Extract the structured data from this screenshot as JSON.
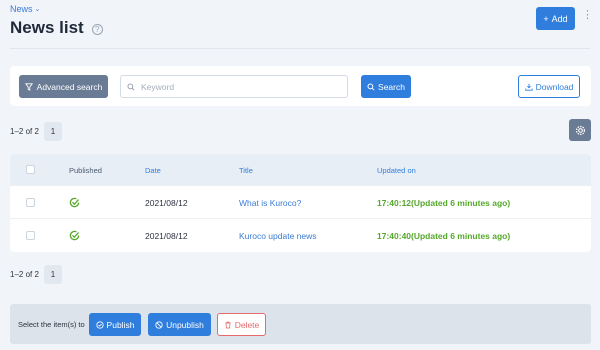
{
  "breadcrumb": {
    "label": "News"
  },
  "header": {
    "title": "News list",
    "help_icon": "question-circle-icon",
    "add_label": "Add"
  },
  "search": {
    "advanced_label": "Advanced search",
    "keyword_placeholder": "Keyword",
    "keyword_value": "",
    "search_label": "Search",
    "download_label": "Download"
  },
  "pagination": {
    "summary": "1–2 of 2",
    "page": "1"
  },
  "table": {
    "columns": [
      "Published",
      "Date",
      "Title",
      "Updated on"
    ],
    "rows": [
      {
        "published": true,
        "date": "2021/08/12",
        "title": "What is Kuroco?",
        "updated": "17:40:12(Updated 6 minutes ago)"
      },
      {
        "published": true,
        "date": "2021/08/12",
        "title": "Kuroco update news",
        "updated": "17:40:40(Updated 6 minutes ago)"
      }
    ]
  },
  "bulk": {
    "label": "Select the item(s) to",
    "publish_label": "Publish",
    "unpublish_label": "Unpublish",
    "delete_label": "Delete"
  },
  "colors": {
    "primary": "#2f7ddc",
    "secondary": "#6a7b95",
    "success": "#56a82c",
    "danger": "#e56a6a",
    "link": "#3a7bd5"
  }
}
